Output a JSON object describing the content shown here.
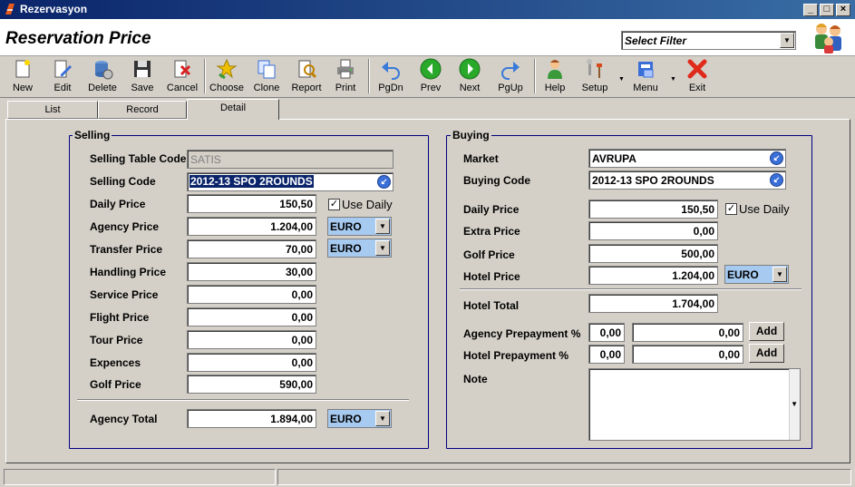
{
  "window": {
    "title": "Rezervasyon"
  },
  "header": {
    "page_title": "Reservation Price",
    "filter_value": "Select Filter"
  },
  "toolbar": {
    "new": "New",
    "edit": "Edit",
    "delete": "Delete",
    "save": "Save",
    "cancel": "Cancel",
    "choose": "Choose",
    "clone": "Clone",
    "report": "Report",
    "print": "Print",
    "pgdn": "PgDn",
    "prev": "Prev",
    "next": "Next",
    "pgup": "PgUp",
    "help": "Help",
    "setup": "Setup",
    "menu": "Menu",
    "exit": "Exit"
  },
  "tabs": {
    "list": "List",
    "record": "Record",
    "detail": "Detail"
  },
  "selling": {
    "title": "Selling",
    "table_code_label": "Selling Table Code",
    "table_code": "SATIS",
    "code_label": "Selling Code",
    "code": "2012-13 SPO 2ROUNDS",
    "daily_label": "Daily Price",
    "daily": "150,50",
    "use_daily": "Use Daily",
    "agency_label": "Agency Price",
    "agency": "1.204,00",
    "agency_cur": "EURO",
    "transfer_label": "Transfer Price",
    "transfer": "70,00",
    "transfer_cur": "EURO",
    "handling_label": "Handling Price",
    "handling": "30,00",
    "service_label": "Service Price",
    "service": "0,00",
    "flight_label": "Flight Price",
    "flight": "0,00",
    "tour_label": "Tour Price",
    "tour": "0,00",
    "expences_label": "Expences",
    "expences": "0,00",
    "golf_label": "Golf Price",
    "golf": "590,00",
    "total_label": "Agency Total",
    "total": "1.894,00",
    "total_cur": "EURO"
  },
  "buying": {
    "title": "Buying",
    "market_label": "Market",
    "market": "AVRUPA",
    "code_label": "Buying Code",
    "code": "2012-13 SPO 2ROUNDS",
    "daily_label": "Daily Price",
    "daily": "150,50",
    "use_daily": "Use Daily",
    "extra_label": "Extra Price",
    "extra": "0,00",
    "golf_label": "Golf Price",
    "golf": "500,00",
    "hotel_label": "Hotel Price",
    "hotel": "1.204,00",
    "hotel_cur": "EURO",
    "hotel_total_label": "Hotel Total",
    "hotel_total": "1.704,00",
    "agency_prepay_label": "Agency Prepayment %",
    "agency_prepay_pct": "0,00",
    "agency_prepay_amt": "0,00",
    "hotel_prepay_label": "Hotel Prepayment %",
    "hotel_prepay_pct": "0,00",
    "hotel_prepay_amt": "0,00",
    "add_label": "Add",
    "note_label": "Note"
  }
}
